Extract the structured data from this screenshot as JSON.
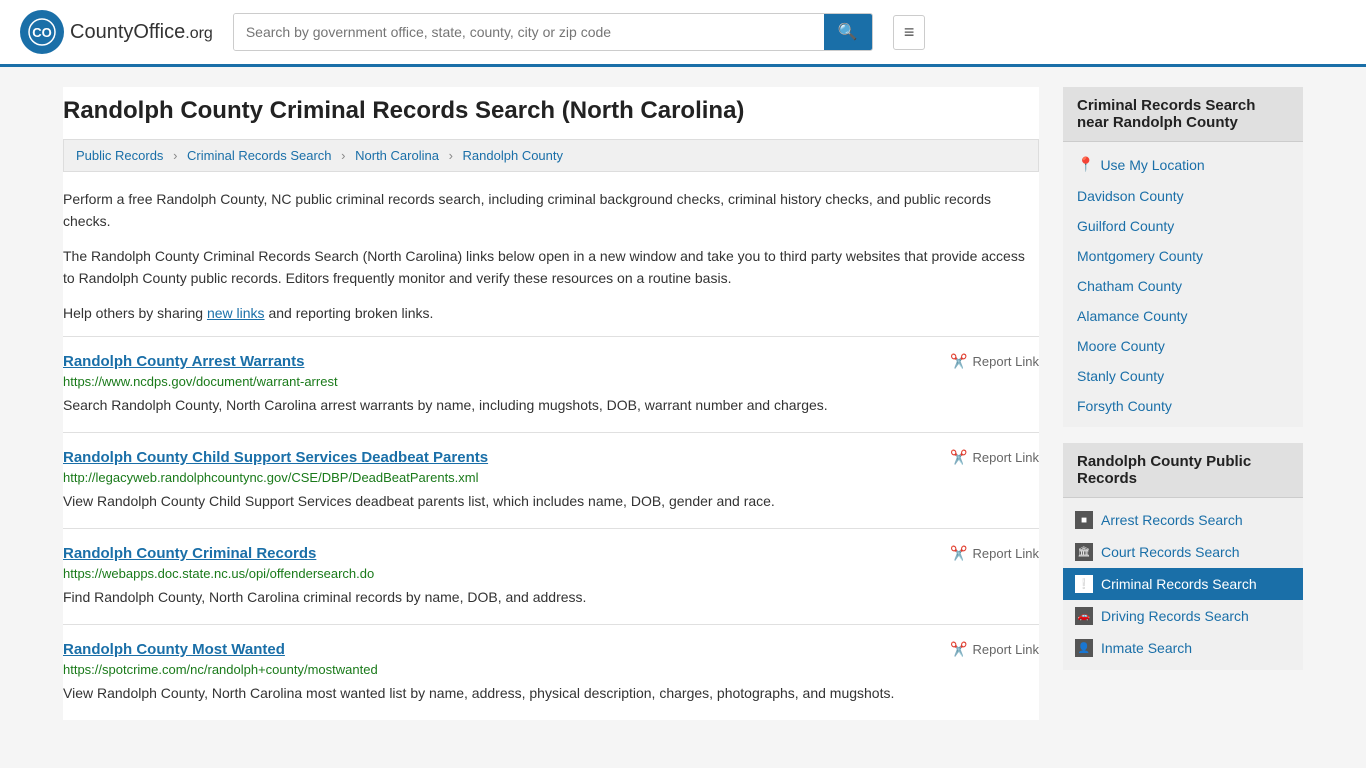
{
  "header": {
    "logo_name": "CountyOffice",
    "logo_suffix": ".org",
    "search_placeholder": "Search by government office, state, county, city or zip code"
  },
  "page": {
    "title": "Randolph County Criminal Records Search (North Carolina)"
  },
  "breadcrumb": {
    "items": [
      {
        "label": "Public Records",
        "href": "#"
      },
      {
        "label": "Criminal Records Search",
        "href": "#"
      },
      {
        "label": "North Carolina",
        "href": "#"
      },
      {
        "label": "Randolph County",
        "href": "#"
      }
    ]
  },
  "intro": {
    "para1": "Perform a free Randolph County, NC public criminal records search, including criminal background checks, criminal history checks, and public records checks.",
    "para2": "The Randolph County Criminal Records Search (North Carolina) links below open in a new window and take you to third party websites that provide access to Randolph County public records. Editors frequently monitor and verify these resources on a routine basis.",
    "para3_before": "Help others by sharing ",
    "para3_link": "new links",
    "para3_after": " and reporting broken links."
  },
  "links": [
    {
      "title": "Randolph County Arrest Warrants",
      "url": "https://www.ncdps.gov/document/warrant-arrest",
      "desc": "Search Randolph County, North Carolina arrest warrants by name, including mugshots, DOB, warrant number and charges.",
      "report_label": "Report Link"
    },
    {
      "title": "Randolph County Child Support Services Deadbeat Parents",
      "url": "http://legacyweb.randolphcountync.gov/CSE/DBP/DeadBeatParents.xml",
      "desc": "View Randolph County Child Support Services deadbeat parents list, which includes name, DOB, gender and race.",
      "report_label": "Report Link"
    },
    {
      "title": "Randolph County Criminal Records",
      "url": "https://webapps.doc.state.nc.us/opi/offendersearch.do",
      "desc": "Find Randolph County, North Carolina criminal records by name, DOB, and address.",
      "report_label": "Report Link"
    },
    {
      "title": "Randolph County Most Wanted",
      "url": "https://spotcrime.com/nc/randolph+county/mostwanted",
      "desc": "View Randolph County, North Carolina most wanted list by name, address, physical description, charges, photographs, and mugshots.",
      "report_label": "Report Link"
    }
  ],
  "sidebar": {
    "nearby_header": "Criminal Records Search near Randolph County",
    "use_my_location": "Use My Location",
    "nearby_counties": [
      "Davidson County",
      "Guilford County",
      "Montgomery County",
      "Chatham County",
      "Alamance County",
      "Moore County",
      "Stanly County",
      "Forsyth County"
    ],
    "pub_records_header": "Randolph County Public Records",
    "pub_records_items": [
      {
        "label": "Arrest Records Search",
        "icon": "■",
        "active": false
      },
      {
        "label": "Court Records Search",
        "icon": "🏛",
        "active": false
      },
      {
        "label": "Criminal Records Search",
        "icon": "!",
        "active": true
      },
      {
        "label": "Driving Records Search",
        "icon": "🚗",
        "active": false
      },
      {
        "label": "Inmate Search",
        "icon": "👤",
        "active": false
      }
    ]
  }
}
